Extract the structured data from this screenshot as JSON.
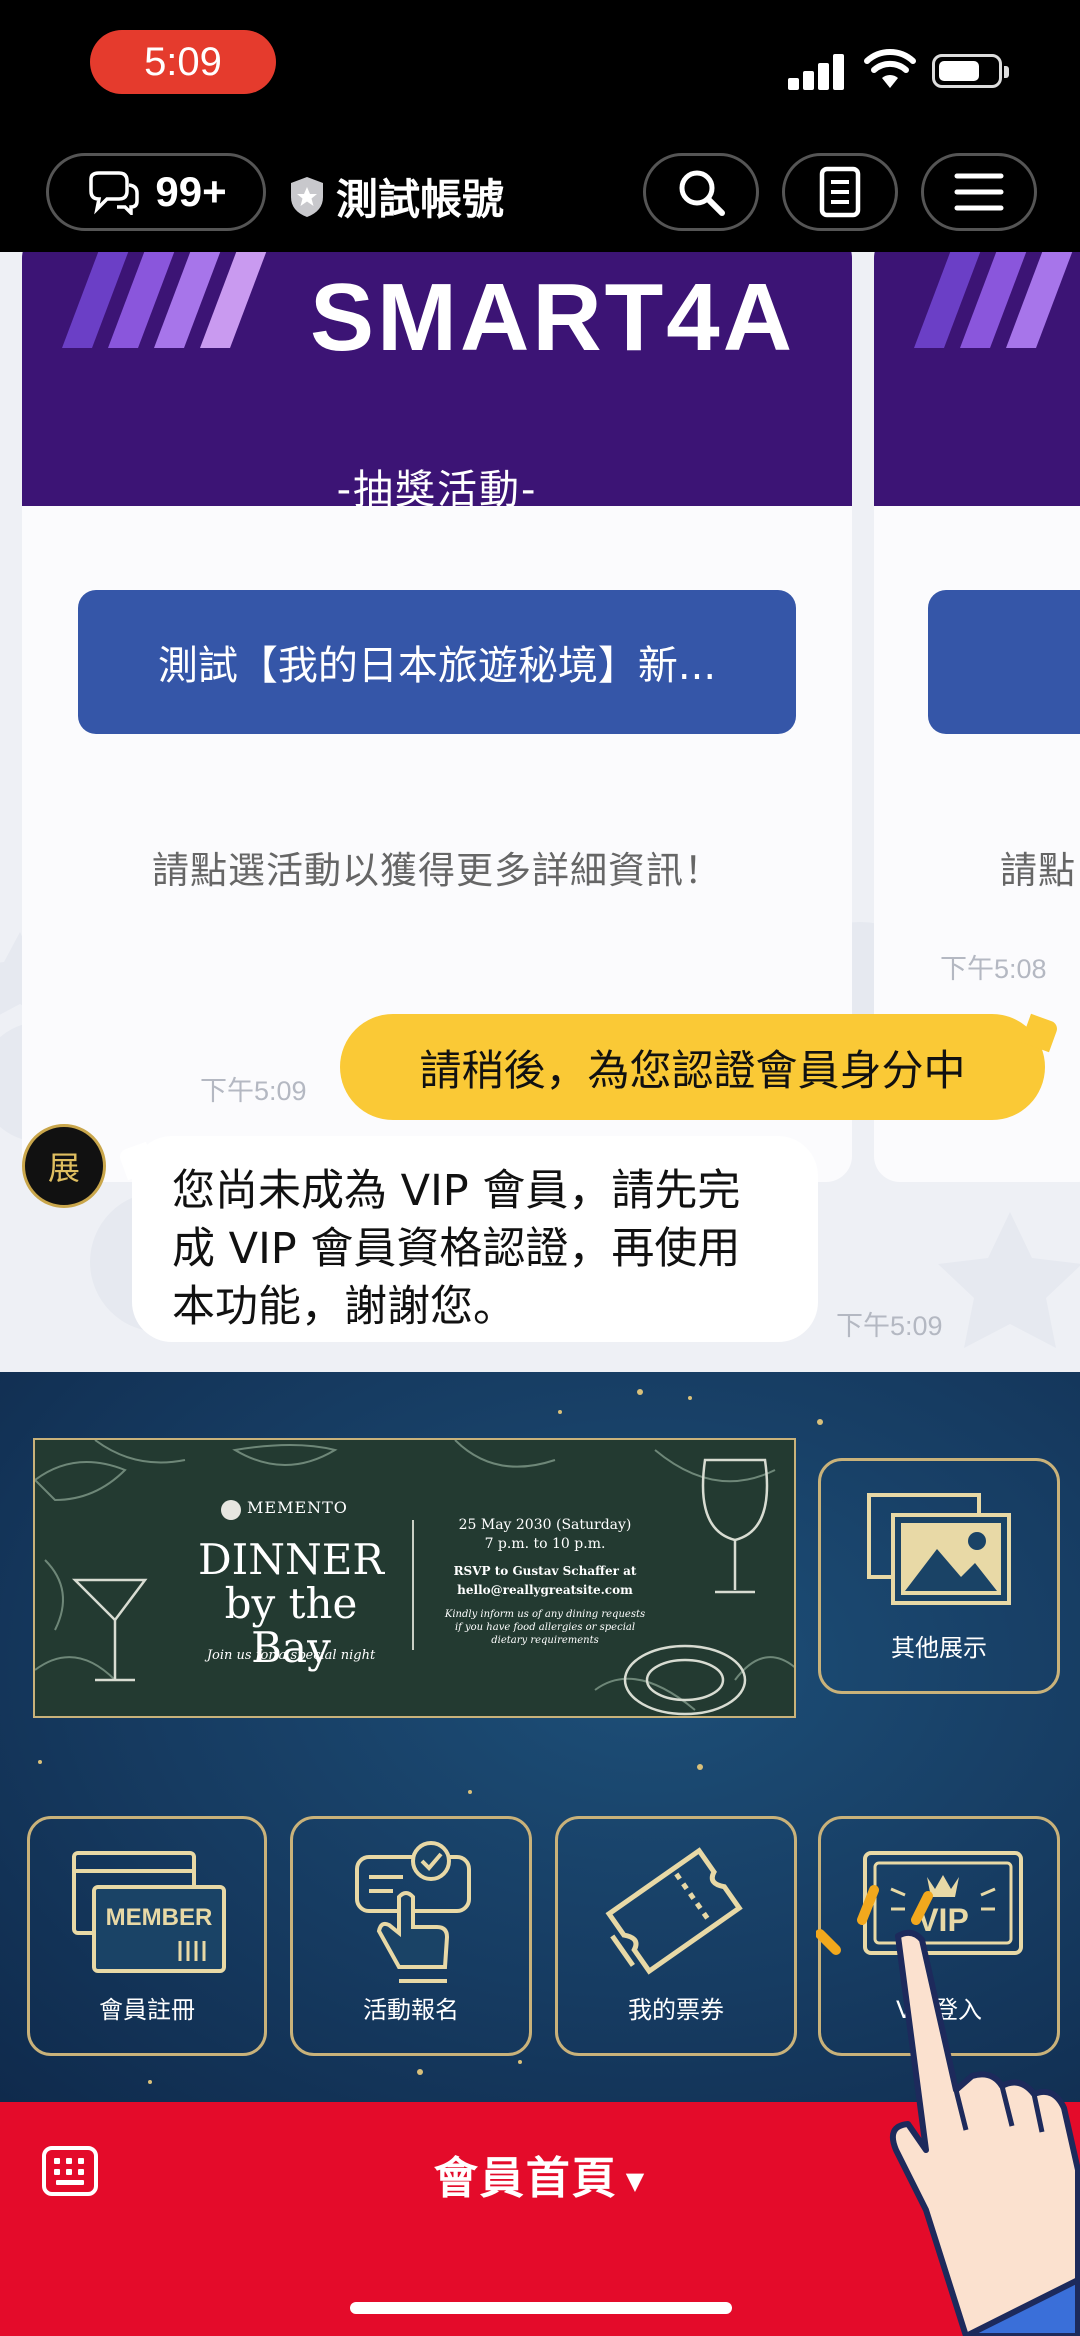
{
  "status_bar": {
    "time": "5:09"
  },
  "top_bar": {
    "notification_count": "99+",
    "account_name": "測試帳號"
  },
  "chat": {
    "card": {
      "brand": "SMART4A",
      "subtitle": "-抽獎活動-",
      "button_label": "測試【我的日本旅遊秘境】新...",
      "hint": "請點選活動以獲得更多詳細資訊！"
    },
    "card_next": {
      "hint": "請點"
    },
    "timestamp_1": "下午5:08",
    "user_message": "請稍後，為您認證會員身分中",
    "timestamp_2": "下午5:09",
    "avatar_char": "展",
    "bot_message_line1": "您尚未成為 VIP 會員，請先完",
    "bot_message_line2": "成 VIP 會員資格認證，再使用",
    "bot_message_line3": "本功能，謝謝您。",
    "timestamp_3": "下午5:09"
  },
  "rich_menu": {
    "banner": {
      "brand": "MEMENTO",
      "title_line1": "DINNER",
      "title_line2": "by the Bay",
      "tagline": "Join us for a special night",
      "date": "25 May 2030 (Saturday)",
      "time": "7 p.m. to 10 p.m.",
      "rsvp": "RSVP to Gustav Schaffer at",
      "email": "hello@reallygreatsite.com",
      "note_line1": "Kindly inform us of any dining requests",
      "note_line2": "if you have food allergies or special",
      "note_line3": "dietary requirements"
    },
    "tiles": {
      "other": "其他展示",
      "member": "會員註冊",
      "event": "活動報名",
      "ticket": "我的票券",
      "vip": "VIP登入"
    },
    "member_card_text": "MEMBER",
    "vip_card_text": "VIP"
  },
  "bottom_bar": {
    "menu_title": "會員首頁"
  },
  "colors": {
    "time_pill": "#e53b2d",
    "brand_purple": "#3c1475",
    "button_blue": "#3556a8",
    "user_bubble": "#fac936",
    "menu_bar_red": "#e40b2a",
    "gold": "#c9b27a"
  }
}
